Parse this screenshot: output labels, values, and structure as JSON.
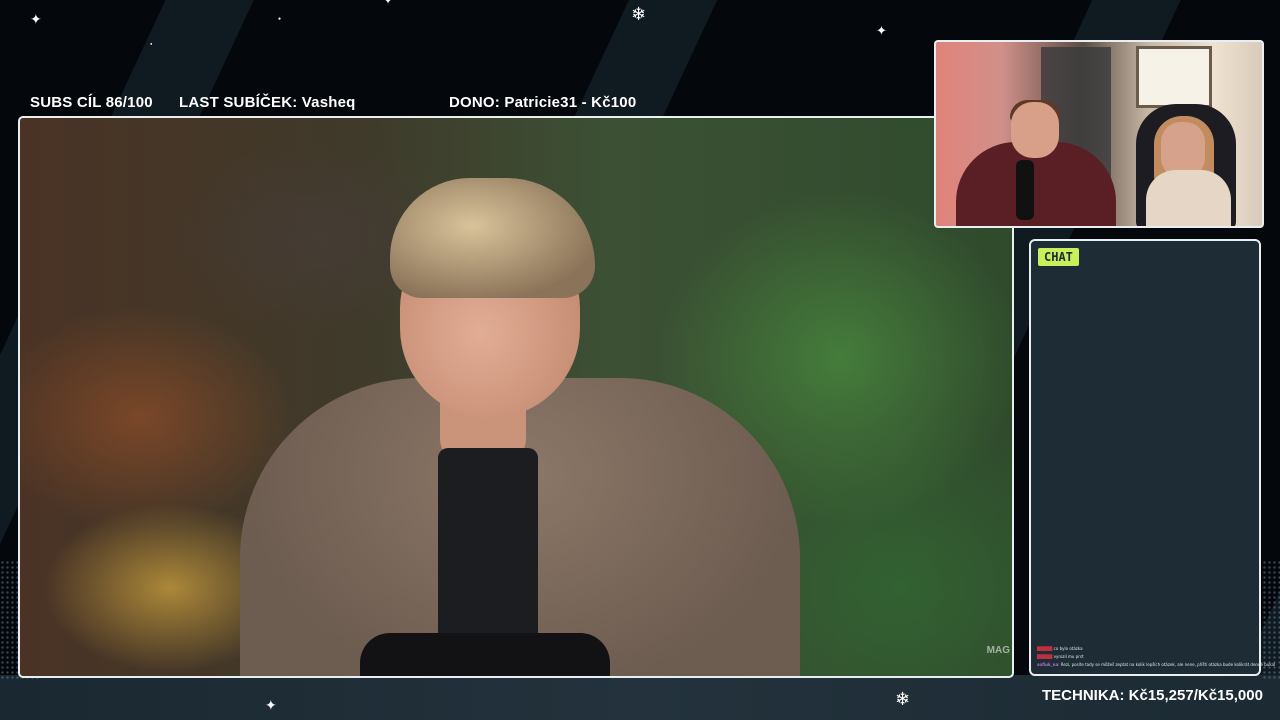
{
  "top_bar": {
    "subs_goal": "SUBS CÍL 86/100",
    "last_sub": "LAST SUBÍČEK: Vasheq",
    "donation": "DONO: Patricie31 - Kč100"
  },
  "main_video": {
    "watermark": "MAG"
  },
  "chat": {
    "label": "CHAT",
    "messages": [
      {
        "user": "",
        "user_color": "#c03040",
        "text": "co bylo otázka"
      },
      {
        "user": "",
        "user_color": "#c03040",
        "text": "vyrozil mu prst"
      },
      {
        "user": "sofiuk_na",
        "user_color": "#b070d0",
        "text": "Rezi, posíte tady se můžeš zeptat na kolik lepších otázek, ale nene, příští otázka bude kolikrát denně bukal"
      }
    ]
  },
  "bottom": {
    "technika": "TECHNIKA: Kč15,257/Kč15,000"
  },
  "colors": {
    "panel_border": "#e9eef0",
    "chat_bg": "#1e2c35",
    "chat_label_bg": "#c8f05a"
  },
  "icons": [
    "star-icon",
    "snowflake-icon"
  ]
}
